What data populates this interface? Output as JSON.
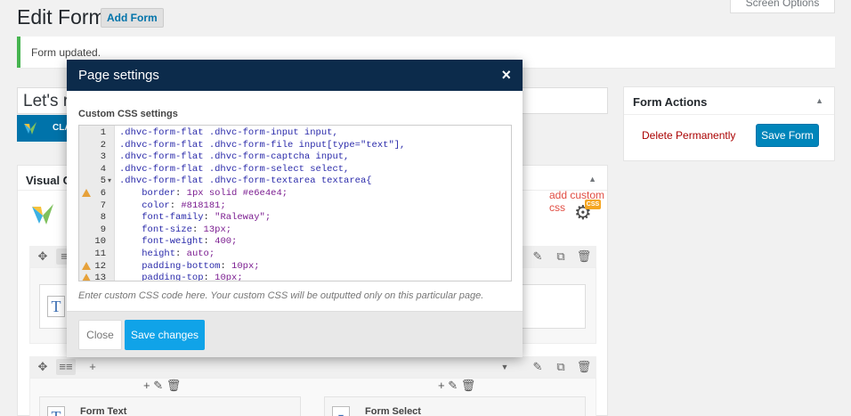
{
  "header": {
    "title": "Edit Form",
    "add_form_label": "Add Form",
    "screen_options_label": "Screen Options"
  },
  "notice": {
    "text": "Form updated."
  },
  "title_field": {
    "value": "Let's r"
  },
  "classic_tab": {
    "label": "CLA"
  },
  "visual_composer": {
    "title": "Visual C",
    "add_custom_css_label": "add custom css",
    "css_badge": "CSS",
    "elements": [
      {
        "icon": "T",
        "label": "Form Text"
      },
      {
        "icon": "▾",
        "label": "Form Select"
      }
    ]
  },
  "form_actions": {
    "title": "Form Actions",
    "delete_label": "Delete Permanently",
    "save_label": "Save Form"
  },
  "modal": {
    "title": "Page settings",
    "close_glyph": "×",
    "section_label": "Custom CSS settings",
    "hint": "Enter custom CSS code here. Your custom CSS will be outputted only on this particular page.",
    "close_label": "Close",
    "save_label": "Save changes",
    "code_lines": [
      {
        "n": "1",
        "warn": false,
        "fold": false,
        "text": ".dhvc-form-flat .dhvc-form-input input,"
      },
      {
        "n": "2",
        "warn": false,
        "fold": false,
        "text": ".dhvc-form-flat .dhvc-form-file input[type=\"text\"],"
      },
      {
        "n": "3",
        "warn": false,
        "fold": false,
        "text": ".dhvc-form-flat .dhvc-form-captcha input,"
      },
      {
        "n": "4",
        "warn": false,
        "fold": false,
        "text": ".dhvc-form-flat .dhvc-form-select select,"
      },
      {
        "n": "5",
        "warn": false,
        "fold": true,
        "text": ".dhvc-form-flat .dhvc-form-textarea textarea{"
      },
      {
        "n": "6",
        "warn": true,
        "fold": false,
        "text": "    border: 1px solid #e6e4e4;"
      },
      {
        "n": "7",
        "warn": false,
        "fold": false,
        "text": "    color: #818181;"
      },
      {
        "n": "8",
        "warn": false,
        "fold": false,
        "text": "    font-family: \"Raleway\";"
      },
      {
        "n": "9",
        "warn": false,
        "fold": false,
        "text": "    font-size: 13px;"
      },
      {
        "n": "10",
        "warn": false,
        "fold": false,
        "text": "    font-weight: 400;"
      },
      {
        "n": "11",
        "warn": false,
        "fold": false,
        "text": "    height: auto;"
      },
      {
        "n": "12",
        "warn": true,
        "fold": false,
        "text": "    padding-bottom: 10px;"
      },
      {
        "n": "13",
        "warn": true,
        "fold": false,
        "text": "    padding-top: 10px;"
      }
    ]
  },
  "colors": {
    "modal_header": "#0c2b4b",
    "save_changes": "#10a3e8",
    "save_form": "#0085ba",
    "notice_border": "#46b450"
  }
}
